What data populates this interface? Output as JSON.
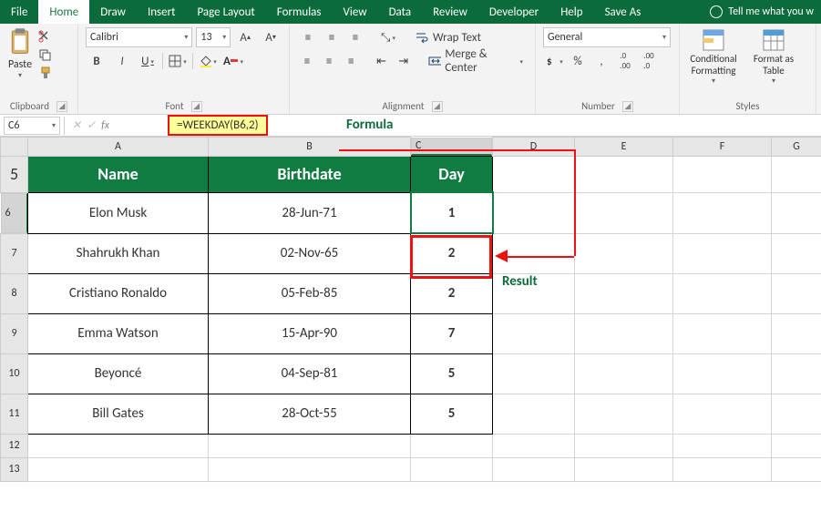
{
  "menu": {
    "file": "File",
    "home": "Home",
    "draw": "Draw",
    "insert": "Insert",
    "pageLayout": "Page Layout",
    "formulas": "Formulas",
    "view": "View",
    "data": "Data",
    "review": "Review",
    "developer": "Developer",
    "help": "Help",
    "saveAs": "Save As",
    "tellMe": "Tell me what you w"
  },
  "clipboard": {
    "paste": "Paste",
    "title": "Clipboard"
  },
  "font": {
    "name": "Calibri",
    "size": "13",
    "bold": "B",
    "italic": "I",
    "underline": "U",
    "title": "Font"
  },
  "alignment": {
    "wrap": "Wrap Text",
    "merge": "Merge & Center",
    "title": "Alignment"
  },
  "number": {
    "format": "General",
    "pct": "%",
    "comma": ",",
    "incDec": ".0",
    "title": "Number"
  },
  "styles": {
    "cond": "Conditional Formatting",
    "table": "Format as Table",
    "title": "Styles"
  },
  "fx": {
    "cell": "C6",
    "formula": "=WEEKDAY(B6,2)",
    "fxLabel": "fx"
  },
  "annotations": {
    "formula": "Formula",
    "result": "Result"
  },
  "cols": [
    "A",
    "B",
    "C",
    "D",
    "E",
    "F",
    "G"
  ],
  "headerRow": {
    "num": "5",
    "name": "Name",
    "birth": "Birthdate",
    "day": "Day"
  },
  "rows": [
    {
      "num": "6",
      "name": "Elon Musk",
      "birth": "28-Jun-71",
      "day": "1"
    },
    {
      "num": "7",
      "name": "Shahrukh Khan",
      "birth": "02-Nov-65",
      "day": "2"
    },
    {
      "num": "8",
      "name": "Cristiano Ronaldo",
      "birth": "05-Feb-85",
      "day": "2"
    },
    {
      "num": "9",
      "name": "Emma Watson",
      "birth": "15-Apr-90",
      "day": "7"
    },
    {
      "num": "10",
      "name": "Beyoncé",
      "birth": "04-Sep-81",
      "day": "5"
    },
    {
      "num": "11",
      "name": "Bill Gates",
      "birth": "28-Oct-55",
      "day": "5"
    }
  ],
  "emptyRows": [
    "12",
    "13"
  ],
  "chart_data": {
    "type": "table",
    "title": "WEEKDAY(birthdate,2) results",
    "columns": [
      "Name",
      "Birthdate",
      "Day"
    ],
    "rows": [
      [
        "Elon Musk",
        "28-Jun-71",
        1
      ],
      [
        "Shahrukh Khan",
        "02-Nov-65",
        2
      ],
      [
        "Cristiano Ronaldo",
        "05-Feb-85",
        2
      ],
      [
        "Emma Watson",
        "15-Apr-90",
        7
      ],
      [
        "Beyoncé",
        "04-Sep-81",
        5
      ],
      [
        "Bill Gates",
        "28-Oct-55",
        5
      ]
    ]
  }
}
